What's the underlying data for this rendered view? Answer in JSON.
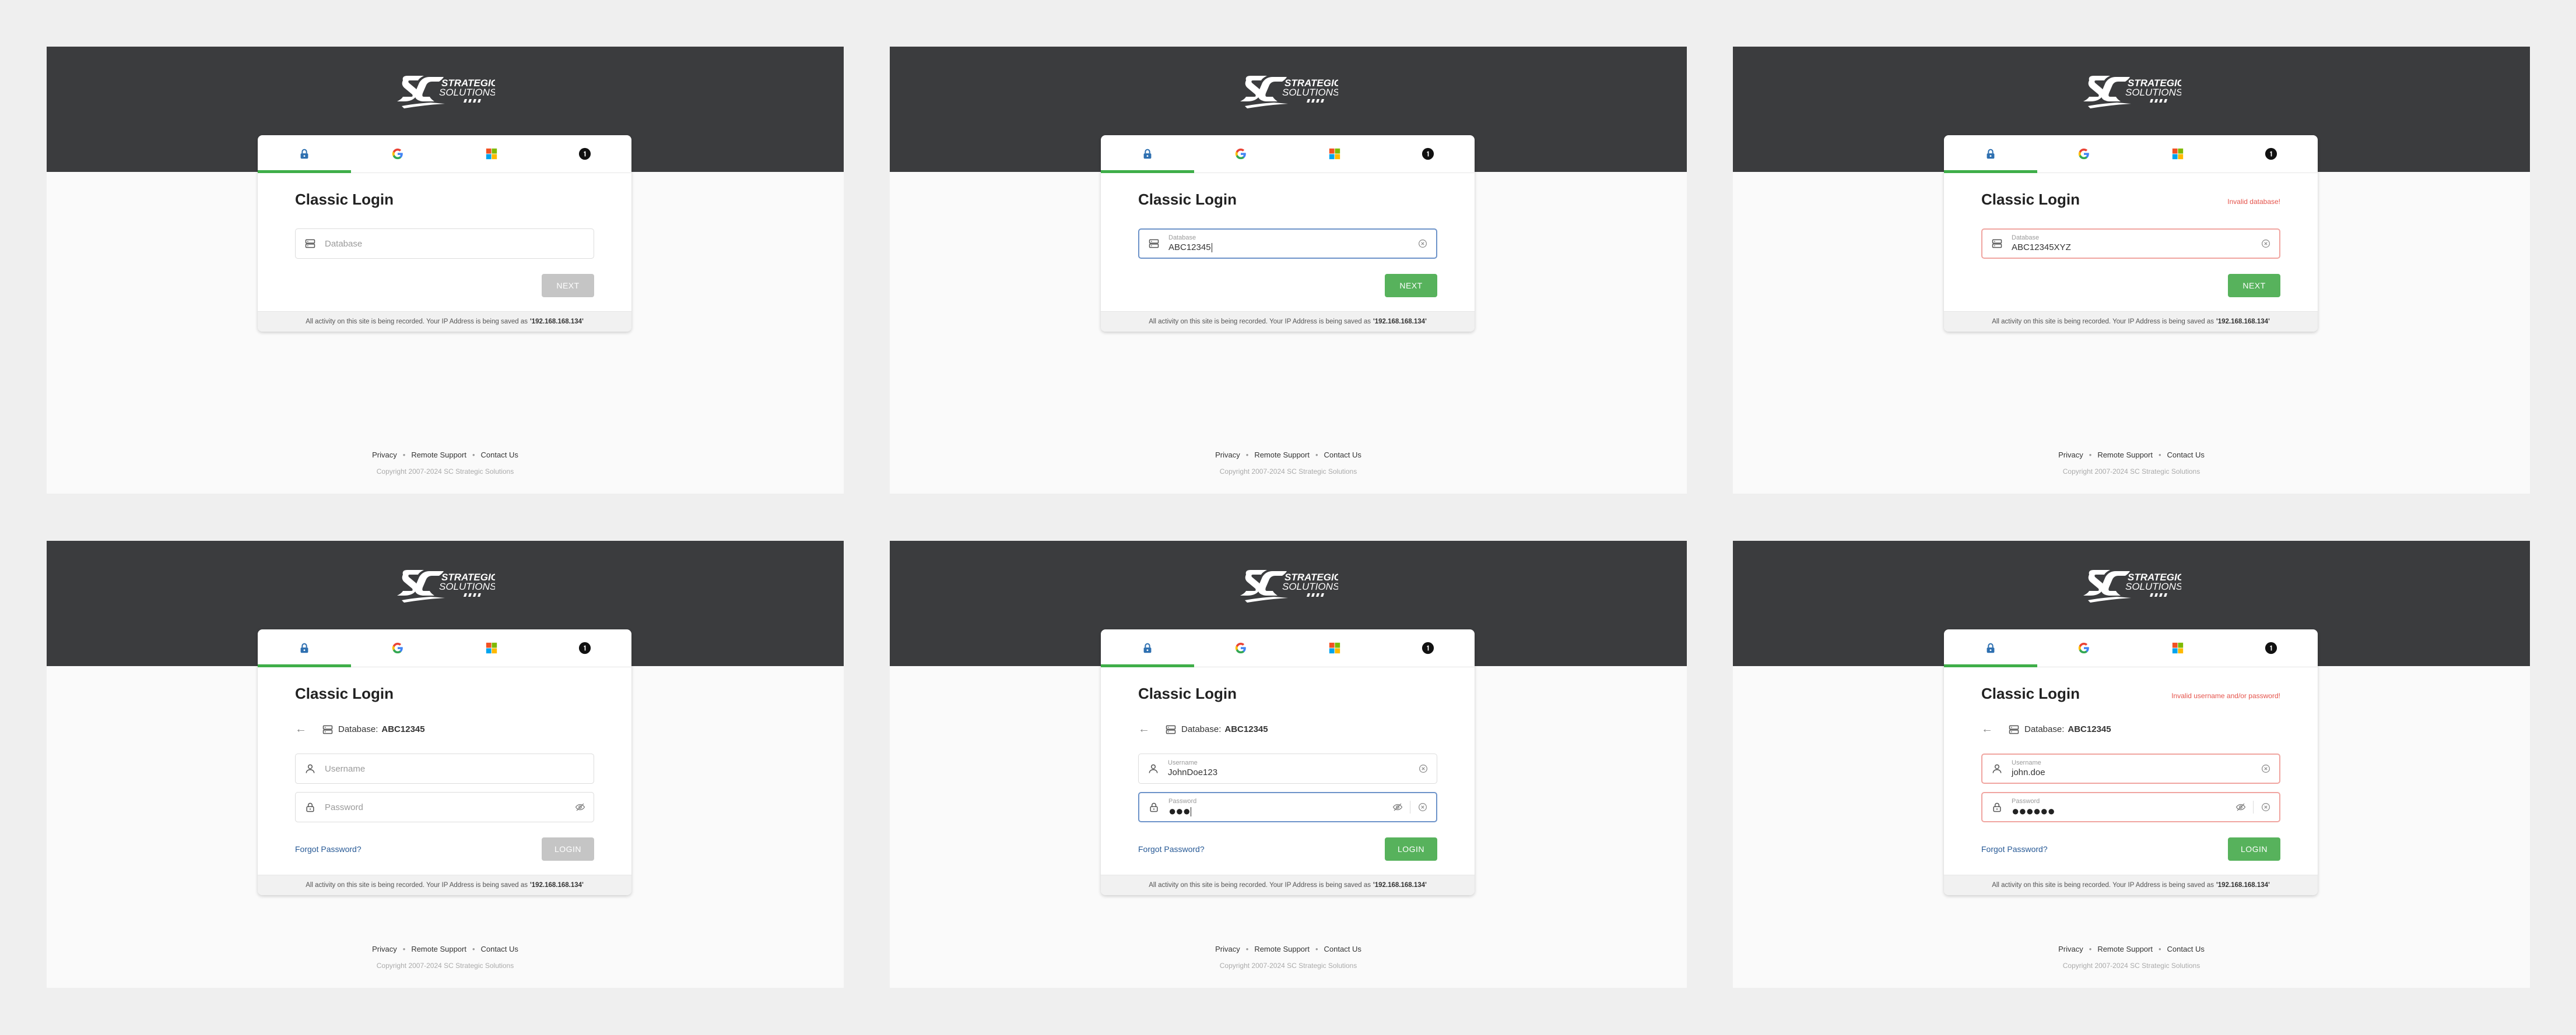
{
  "brand": {
    "line1": "STRATEGIC",
    "line2": "SOLUTIONS"
  },
  "colors": {
    "header": "#3b3c3e",
    "accent": "#3fae49",
    "button": "#57b25c",
    "error": "#e5534b",
    "focus": "#6d93c9",
    "link": "#285a96"
  },
  "tabs": [
    {
      "name": "classic",
      "icon": "lock-icon"
    },
    {
      "name": "google",
      "icon": "google-icon"
    },
    {
      "name": "microsoft",
      "icon": "microsoft-icon"
    },
    {
      "name": "onelogin",
      "icon": "onelogin-icon"
    }
  ],
  "common": {
    "title": "Classic Login",
    "notice_text": "All activity on this site is being recorded. Your IP Address is being saved as",
    "ip": "192.168.168.134",
    "back_icon": "arrow-left-icon",
    "forgot": "Forgot Password?",
    "db_prefix": "Database:",
    "footer_links": [
      "Privacy",
      "Remote Support",
      "Contact Us"
    ],
    "copyright": "Copyright 2007-2024 SC Strategic Solutions"
  },
  "panels": [
    {
      "database": {
        "placeholder": "Database"
      },
      "button": "NEXT"
    },
    {
      "database": {
        "label": "Database",
        "value": "ABC12345"
      },
      "button": "NEXT"
    },
    {
      "error": "Invalid database!",
      "database": {
        "label": "Database",
        "value": "ABC12345XYZ"
      },
      "button": "NEXT"
    },
    {
      "db_value": "ABC12345",
      "username": {
        "placeholder": "Username"
      },
      "password": {
        "placeholder": "Password"
      },
      "button": "LOGIN"
    },
    {
      "db_value": "ABC12345",
      "username": {
        "label": "Username",
        "value": "JohnDoe123"
      },
      "password": {
        "label": "Password",
        "dots": "●●●"
      },
      "button": "LOGIN"
    },
    {
      "error": "Invalid username and/or password!",
      "db_value": "ABC12345",
      "username": {
        "label": "Username",
        "value": "john.doe"
      },
      "password": {
        "label": "Password",
        "dots": "●●●●●●"
      },
      "button": "LOGIN"
    }
  ]
}
